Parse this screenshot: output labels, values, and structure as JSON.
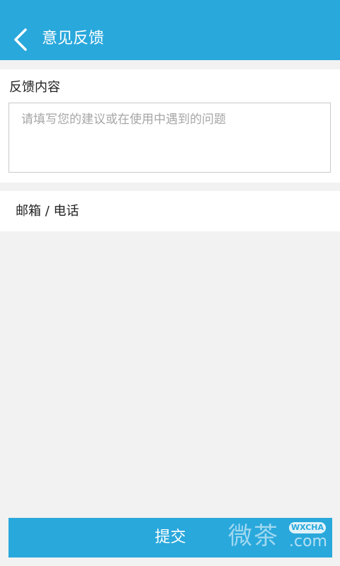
{
  "header": {
    "title": "意见反馈",
    "back_icon": "chevron-left-icon"
  },
  "feedback": {
    "label": "反馈内容",
    "placeholder": "请填写您的建议或在使用中遇到的问题",
    "value": ""
  },
  "contact": {
    "placeholder": "邮箱 / 电话",
    "value": ""
  },
  "submit": {
    "label": "提交"
  },
  "watermark": {
    "chars": "微茶",
    "badge": "WXCHA",
    "domain": ".com"
  },
  "colors": {
    "accent": "#29a8dc",
    "background": "#f2f2f2",
    "panel": "#ffffff",
    "border": "#c9c9c9"
  }
}
